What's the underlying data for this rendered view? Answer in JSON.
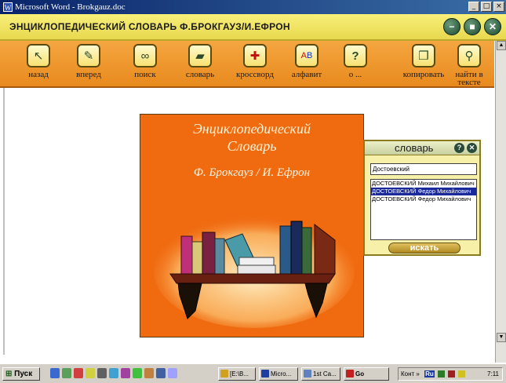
{
  "window": {
    "title": "Microsoft Word - Brokgauz.doc",
    "buttons": [
      "_",
      "□",
      "×"
    ]
  },
  "app": {
    "title": "ЭНЦИКЛОПЕДИЧЕСКИЙ СЛОВАРЬ Ф.БРОКГАУЗ/И.ЕФРОН"
  },
  "toolbar": {
    "items": [
      {
        "label": "назад",
        "icon": "back-arrow-icon"
      },
      {
        "label": "вперед",
        "icon": "forward-arrow-icon"
      },
      {
        "label": "поиск",
        "icon": "binoculars-icon"
      },
      {
        "label": "словарь",
        "icon": "book-icon"
      },
      {
        "label": "кроссворд",
        "icon": "crossword-icon"
      },
      {
        "label": "алфавит",
        "icon": "alphabet-icon"
      },
      {
        "label": "о ...",
        "icon": "question-icon"
      },
      {
        "label": "копировать",
        "icon": "copy-icon"
      },
      {
        "label": "найти в тексте",
        "icon": "magnifier-icon"
      }
    ]
  },
  "cover": {
    "title_line1": "Энциклопедический",
    "title_line2": "Словарь",
    "authors": "Ф. Брокгауз / И. Ефрон"
  },
  "dictionary": {
    "title": "словарь",
    "query": "Достоевский",
    "results": [
      "ДОСТОЕВСКИЙ Михаил Михайлович",
      "ДОСТОЕВСКИЙ Федор Михайлович",
      "ДОСТОЕВСКИЙ Федор Михайлович"
    ],
    "selected_index": 1,
    "search_label": "искать"
  },
  "taskbar": {
    "start_label": "Пуск",
    "tasks": [
      "[E:\\B...",
      "Micro...",
      "1st Ca...",
      "Go"
    ],
    "tray_text": "Конт »",
    "tray_lang": "Ru",
    "clock": "7:11"
  },
  "colors": {
    "header_yellow": "#f0e050",
    "toolbar_orange": "#ee9428",
    "cover_orange": "#f06a10",
    "selection_blue": "#1a2a9a"
  }
}
